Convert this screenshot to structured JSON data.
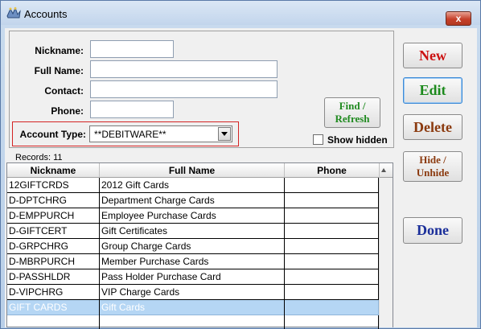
{
  "window": {
    "title": "Accounts",
    "close_label": "x"
  },
  "form": {
    "nickname_label": "Nickname:",
    "nickname_value": "",
    "fullname_label": "Full Name:",
    "fullname_value": "",
    "contact_label": "Contact:",
    "contact_value": "",
    "phone_label": "Phone:",
    "phone_value": "",
    "account_type_label": "Account Type:",
    "account_type_value": "**DEBITWARE**",
    "find_label_1": "Find /",
    "find_label_2": "Refresh",
    "show_hidden_label": "Show hidden",
    "show_hidden_checked": false
  },
  "records": {
    "label": "Records:",
    "count": "11"
  },
  "grid": {
    "columns": [
      "Nickname",
      "Full Name",
      "Phone"
    ],
    "rows": [
      {
        "nickname": "12GIFTCRDS",
        "fullname": "2012 Gift Cards",
        "phone": ""
      },
      {
        "nickname": "D-DPTCHRG",
        "fullname": "Department Charge Cards",
        "phone": ""
      },
      {
        "nickname": "D-EMPPURCH",
        "fullname": "Employee Purchase Cards",
        "phone": ""
      },
      {
        "nickname": "D-GIFTCERT",
        "fullname": "Gift Certificates",
        "phone": ""
      },
      {
        "nickname": "D-GRPCHRG",
        "fullname": "Group Charge Cards",
        "phone": ""
      },
      {
        "nickname": "D-MBRPURCH",
        "fullname": "Member Purchase Cards",
        "phone": ""
      },
      {
        "nickname": "D-PASSHLDR",
        "fullname": "Pass Holder Purchase Card",
        "phone": ""
      },
      {
        "nickname": "D-VIPCHRG",
        "fullname": "VIP Charge Cards",
        "phone": ""
      },
      {
        "nickname": "GIFT CARDS",
        "fullname": "Gift Cards",
        "phone": "",
        "selected": true
      },
      {
        "nickname": "",
        "fullname": "",
        "phone": ""
      }
    ]
  },
  "buttons": {
    "new": "New",
    "edit": "Edit",
    "delete": "Delete",
    "hide_1": "Hide /",
    "hide_2": "Unhide",
    "done": "Done"
  },
  "colors": {
    "new": "#cc1111",
    "edit": "#1d8a1d",
    "delete": "#8b3a0f",
    "done": "#1b2f9a",
    "selection": "#b5d6f4",
    "account_type_highlight": "#d42424"
  }
}
